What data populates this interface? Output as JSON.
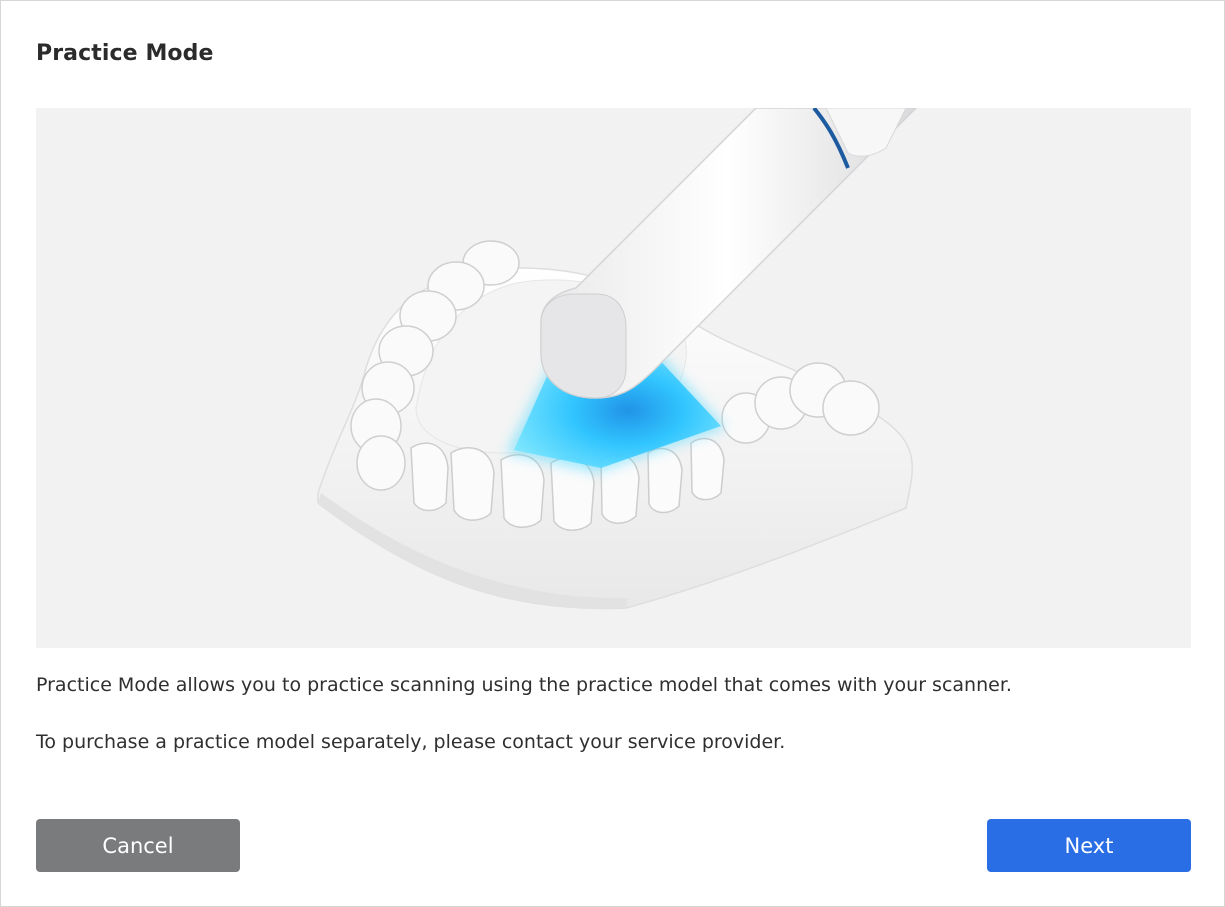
{
  "dialog": {
    "title": "Practice Mode",
    "illustration": {
      "subject": "intraoral-scanner-over-dental-model",
      "colors": {
        "background": "#f2f2f2",
        "scan_light": "#28c8ff",
        "scanner_ring": "#1e5aa0"
      }
    },
    "description": [
      "Practice Mode allows you to practice scanning using the practice model that comes with your scanner.",
      "To purchase a practice model separately, please contact your service provider."
    ],
    "buttons": {
      "cancel_label": "Cancel",
      "next_label": "Next"
    },
    "colors": {
      "cancel_button": "#7a7b7d",
      "next_button": "#2a6ee6"
    }
  }
}
